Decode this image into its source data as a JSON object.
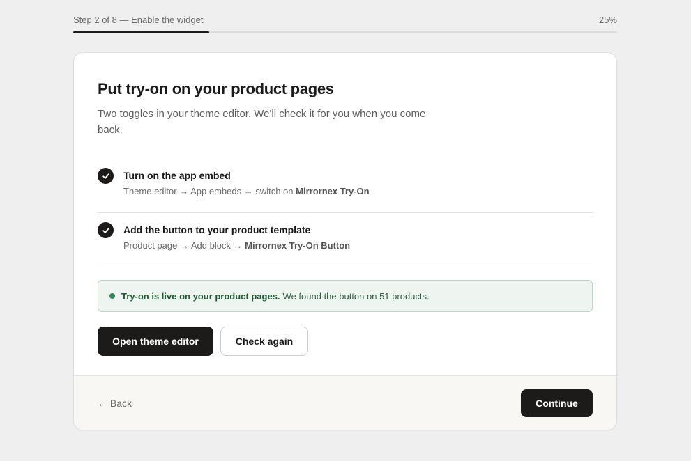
{
  "progress": {
    "label": "Step 2 of 8 — Enable the widget",
    "percent_label": "25%",
    "fill_fraction": 0.25
  },
  "card": {
    "title": "Put try-on on your product pages",
    "subtitle": "Two toggles in your theme editor. We'll check it for you when you come back.",
    "steps": [
      {
        "title": "Turn on the app embed",
        "desc_prefix": "Theme editor → App embeds → switch on",
        "desc_bold": "Mirrornex Try-On",
        "checked": true
      },
      {
        "title": "Add the button to your product template",
        "desc_prefix": "Product page → Add block →",
        "desc_bold": "Mirrornex Try-On Button",
        "checked": true
      }
    ],
    "status": {
      "bold": "Try-on is live on your product pages.",
      "text": "We found the button on 51 products."
    },
    "actions": {
      "primary_label": "Open theme editor",
      "secondary_label": "Check again"
    }
  },
  "footer": {
    "back_label": "← Back",
    "continue_label": "Continue"
  },
  "colors": {
    "accent": "#1c1b19",
    "success_bg": "#eef5f0",
    "success_border": "#b9d7c4",
    "success_dot": "#2f8a52"
  },
  "icons": [
    "check-icon",
    "status-dot-icon",
    "arrow-left-icon"
  ]
}
